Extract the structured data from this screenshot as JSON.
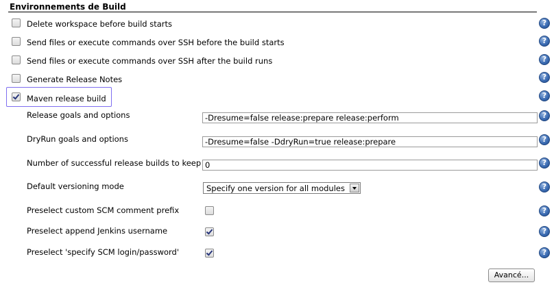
{
  "section": {
    "title": "Environnements de Build"
  },
  "options": [
    {
      "label": "Delete workspace before build starts",
      "checked": false
    },
    {
      "label": "Send files or execute commands over SSH before the build starts",
      "checked": false
    },
    {
      "label": "Send files or execute commands over SSH after the build runs",
      "checked": false
    },
    {
      "label": "Generate Release Notes",
      "checked": false
    },
    {
      "label": "Maven release build",
      "checked": true
    }
  ],
  "maven": {
    "release_goals_label": "Release goals and options",
    "release_goals_value": "-Dresume=false release:prepare release:perform",
    "dryrun_goals_label": "DryRun goals and options",
    "dryrun_goals_value": "-Dresume=false -DdryRun=true release:prepare",
    "num_builds_label": "Number of successful release builds to keep",
    "num_builds_value": "0",
    "versioning_label": "Default versioning mode",
    "versioning_value": "Specify one version for all modules",
    "scm_prefix_label": "Preselect custom SCM comment prefix",
    "scm_prefix_checked": false,
    "append_user_label": "Preselect append Jenkins username",
    "append_user_checked": true,
    "scm_login_label": "Preselect 'specify SCM login/password'",
    "scm_login_checked": true
  },
  "help_icon": "?",
  "advanced_button": "Avancé..."
}
